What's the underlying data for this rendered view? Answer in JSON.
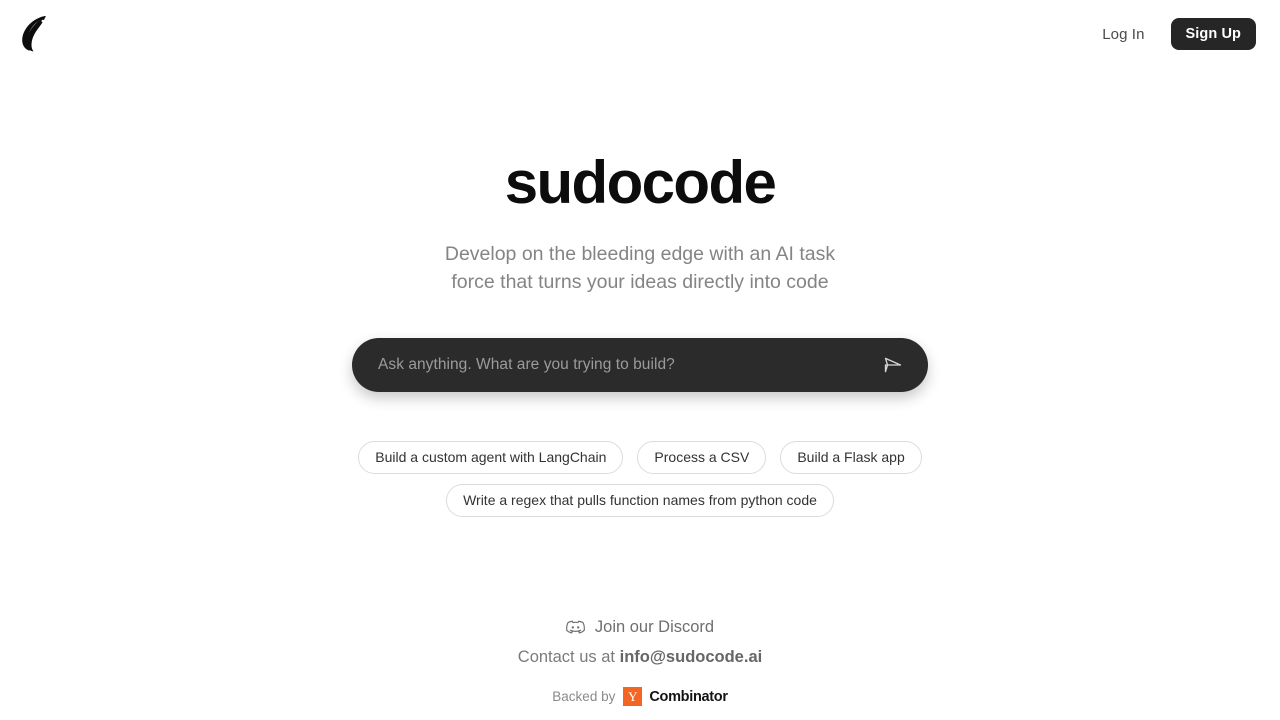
{
  "header": {
    "logo_icon": "sudocode-leaf-logo",
    "login_label": "Log In",
    "signup_label": "Sign Up"
  },
  "hero": {
    "title": "sudocode",
    "subtitle_line1": "Develop on the bleeding edge with an AI task",
    "subtitle_line2": "force that turns your ideas directly into code"
  },
  "prompt": {
    "placeholder": "Ask anything. What are you trying to build?",
    "value": "",
    "send_icon": "send-paper-plane-icon"
  },
  "suggestions": [
    {
      "label": "Build a custom agent with LangChain"
    },
    {
      "label": "Process a CSV"
    },
    {
      "label": "Build a Flask app"
    },
    {
      "label": "Write a regex that pulls function names from python code"
    }
  ],
  "footer": {
    "discord_icon": "discord-icon",
    "discord_label": "Join our Discord",
    "contact_prefix": "Contact us at",
    "contact_email": "info@sudocode.ai",
    "backed_label": "Backed by",
    "yc_letter": "Y",
    "yc_word": "Combinator"
  },
  "colors": {
    "accent_dark": "#2b2b2b",
    "yc_orange": "#F26522",
    "page_background": "#ffffff",
    "muted_text": "#848484"
  }
}
